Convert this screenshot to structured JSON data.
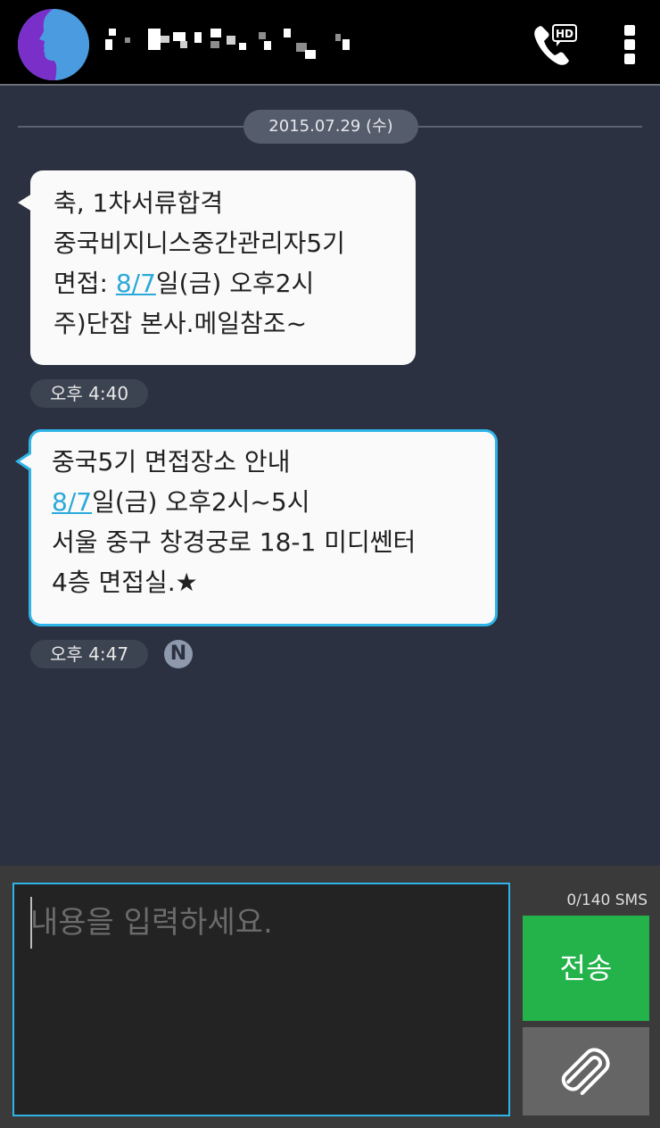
{
  "header": {
    "contact_name_redacted": true,
    "colors": {
      "background": "#000000",
      "avatar_bg": "#4a9be0",
      "avatar_face": "#7a2fc8"
    },
    "icons": {
      "call": "phone-hd-icon",
      "menu": "more-vert-icon"
    },
    "call_badge": "HD"
  },
  "conversation": {
    "date_divider": "2015.07.29 (수)",
    "messages": [
      {
        "lines": [
          [
            {
              "t": "축, 1차서류합격"
            }
          ],
          [
            {
              "t": "중국비지니스중간관리자5기"
            }
          ],
          [
            {
              "t": "면접: "
            },
            {
              "t": "8/7",
              "link": true
            },
            {
              "t": "일(금) 오후2시"
            }
          ],
          [
            {
              "t": "주)단잡 본사.메일참조~"
            }
          ]
        ],
        "time": "오후 4:40",
        "unread": false
      },
      {
        "lines": [
          [
            {
              "t": "중국5기 면접장소 안내"
            }
          ],
          [
            {
              "t": "8/7",
              "link": true
            },
            {
              "t": "일(금) 오후2시~5시"
            }
          ],
          [
            {
              "t": "서울 중구 창경궁로 18-1 미디쎈터"
            }
          ],
          [
            {
              "t": "4층 면접실.★"
            }
          ]
        ],
        "time": "오후 4:47",
        "unread": true,
        "badge": "N"
      }
    ]
  },
  "composer": {
    "placeholder": "내용을 입력하세요.",
    "counter": "0/140  SMS",
    "send_label": "전송",
    "attach_icon": "paperclip-icon",
    "colors": {
      "send": "#23b34a",
      "focus_border": "#2fb4e8",
      "attach": "#656565"
    }
  }
}
